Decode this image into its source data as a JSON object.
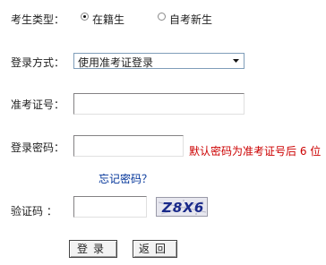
{
  "form": {
    "exam_type_label": "考生类型：",
    "exam_type_options": [
      {
        "label": "在籍生",
        "selected": true
      },
      {
        "label": "自考新生",
        "selected": false
      }
    ],
    "login_method_label": "登录方式：",
    "login_method_value": "使用准考证登录",
    "ticket_label": "准考证号：",
    "ticket_value": "",
    "password_label": "登录密码：",
    "password_value": "",
    "password_hint": "默认密码为准考证号后 6 位",
    "forgot_link": "忘记密码？",
    "captcha_label": "验证码  ：",
    "captcha_value": "",
    "captcha_image_text": "Z8X6",
    "login_button": "登录",
    "back_button": "返回"
  },
  "colors": {
    "hint": "#cc0000",
    "link": "#003399",
    "captcha_text": "#1a2a8a"
  }
}
